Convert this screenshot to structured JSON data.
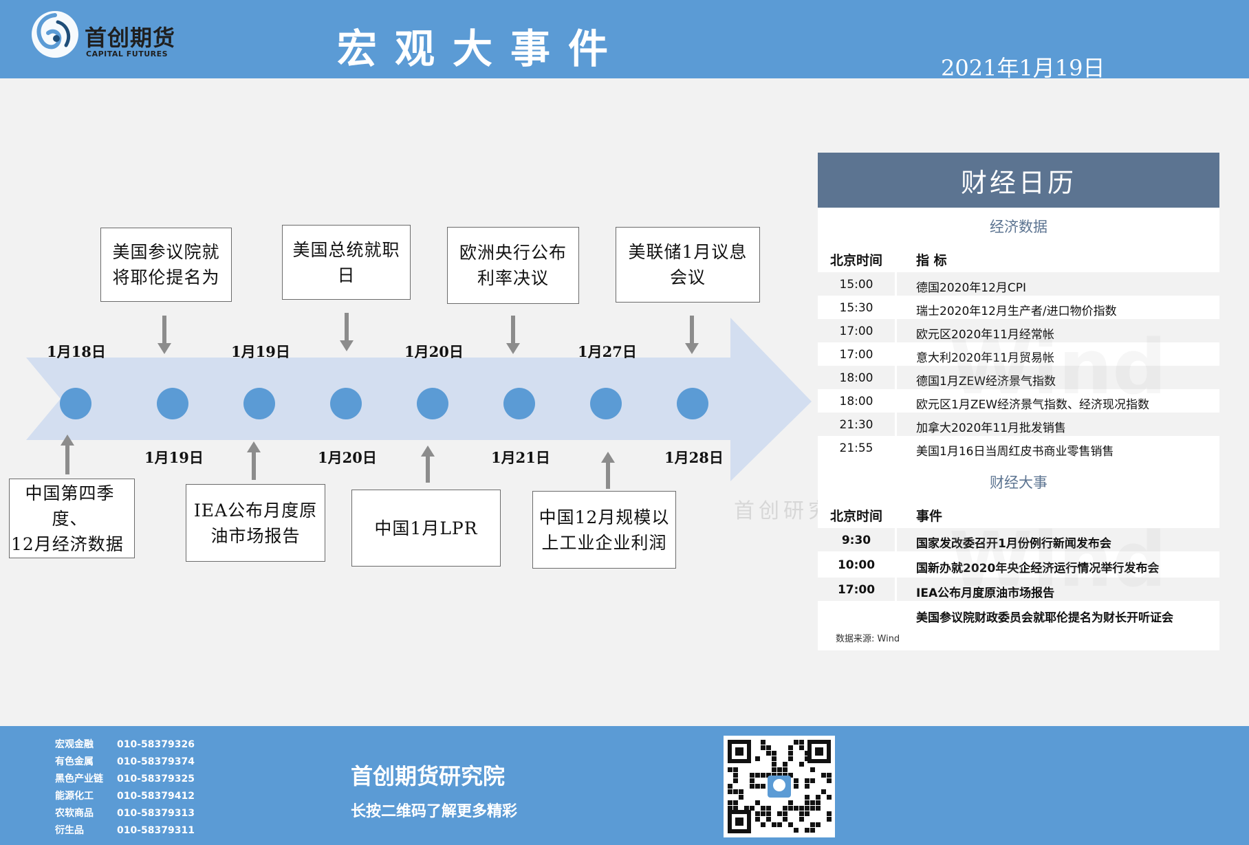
{
  "header": {
    "logo_cn": "首创期货",
    "logo_en": "CAPITAL FUTURES",
    "title": "宏观大事件",
    "date": "2021年1月19日"
  },
  "timeline": {
    "top_dates": [
      "1月18日",
      "1月19日",
      "1月20日",
      "1月27日"
    ],
    "bottom_dates": [
      "1月19日",
      "1月20日",
      "1月21日",
      "1月28日"
    ],
    "top_events": [
      {
        "line1": "美国参议院就",
        "line2": "将耶伦提名为"
      },
      {
        "line1": "美国总统就职",
        "line2": "日"
      },
      {
        "line1": "欧洲央行公布",
        "line2": "利率决议"
      },
      {
        "line1": "美联储1月议息",
        "line2": "会议"
      }
    ],
    "bottom_events": [
      {
        "line1": "中国第四季度、",
        "line2": "12月经济数据"
      },
      {
        "line1": "IEA公布月度原",
        "line2": "油市场报告"
      },
      {
        "line1": "中国1月LPR",
        "line2": ""
      },
      {
        "line1": "中国12月规模以",
        "line2": "上工业企业利润"
      }
    ],
    "colors": {
      "arrow": "#d3def0",
      "dot": "#5b9bd5",
      "pointer": "#8c8c8c"
    }
  },
  "calendar": {
    "title": "财经日历",
    "section_data": "经济数据",
    "data_header": {
      "time": "北京时间",
      "item": "指  标"
    },
    "data_rows": [
      {
        "time": "15:00",
        "item": "德国2020年12月CPI"
      },
      {
        "time": "15:30",
        "item": "瑞士2020年12月生产者/进口物价指数"
      },
      {
        "time": "17:00",
        "item": "欧元区2020年11月经常帐"
      },
      {
        "time": "17:00",
        "item": "意大利2020年11月贸易帐"
      },
      {
        "time": "18:00",
        "item": "德国1月ZEW经济景气指数"
      },
      {
        "time": "18:00",
        "item": "欧元区1月ZEW经济景气指数、经济现况指数"
      },
      {
        "time": "21:30",
        "item": "加拿大2020年11月批发销售"
      },
      {
        "time": "21:55",
        "item": "美国1月16日当周红皮书商业零售销售"
      }
    ],
    "section_events": "财经大事",
    "events_header": {
      "time": "北京时间",
      "item": "事件"
    },
    "event_rows": [
      {
        "time": "9:30",
        "item": "国家发改委召开1月份例行新闻发布会"
      },
      {
        "time": "10:00",
        "item": "国新办就2020年央企经济运行情况举行发布会"
      },
      {
        "time": "17:00",
        "item": "IEA公布月度原油市场报告"
      },
      {
        "time": "",
        "item": "美国参议院财政委员会就耶伦提名为财长开听证会"
      }
    ],
    "source": "数据来源: Wind",
    "watermark": "首创研究",
    "wind_watermark": "Wind"
  },
  "footer": {
    "contacts": [
      {
        "dept": "宏观金融",
        "phone": "010-58379326"
      },
      {
        "dept": "有色金属",
        "phone": "010-58379374"
      },
      {
        "dept": "黑色产业链",
        "phone": "010-58379325"
      },
      {
        "dept": "能源化工",
        "phone": "010-58379412"
      },
      {
        "dept": "农软商品",
        "phone": "010-58379313"
      },
      {
        "dept": "衍生品",
        "phone": "010-58379311"
      }
    ],
    "org": "首创期货研究院",
    "tagline": "长按二维码了解更多精彩"
  }
}
